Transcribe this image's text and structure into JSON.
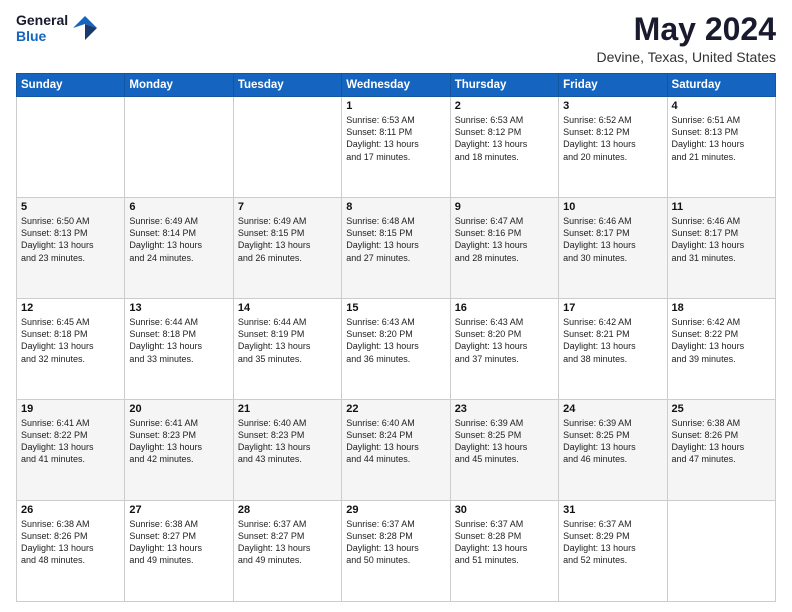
{
  "header": {
    "logo_line1": "General",
    "logo_line2": "Blue",
    "title": "May 2024",
    "subtitle": "Devine, Texas, United States"
  },
  "weekdays": [
    "Sunday",
    "Monday",
    "Tuesday",
    "Wednesday",
    "Thursday",
    "Friday",
    "Saturday"
  ],
  "weeks": [
    [
      {
        "day": "",
        "info": ""
      },
      {
        "day": "",
        "info": ""
      },
      {
        "day": "",
        "info": ""
      },
      {
        "day": "1",
        "info": "Sunrise: 6:53 AM\nSunset: 8:11 PM\nDaylight: 13 hours\nand 17 minutes."
      },
      {
        "day": "2",
        "info": "Sunrise: 6:53 AM\nSunset: 8:12 PM\nDaylight: 13 hours\nand 18 minutes."
      },
      {
        "day": "3",
        "info": "Sunrise: 6:52 AM\nSunset: 8:12 PM\nDaylight: 13 hours\nand 20 minutes."
      },
      {
        "day": "4",
        "info": "Sunrise: 6:51 AM\nSunset: 8:13 PM\nDaylight: 13 hours\nand 21 minutes."
      }
    ],
    [
      {
        "day": "5",
        "info": "Sunrise: 6:50 AM\nSunset: 8:13 PM\nDaylight: 13 hours\nand 23 minutes."
      },
      {
        "day": "6",
        "info": "Sunrise: 6:49 AM\nSunset: 8:14 PM\nDaylight: 13 hours\nand 24 minutes."
      },
      {
        "day": "7",
        "info": "Sunrise: 6:49 AM\nSunset: 8:15 PM\nDaylight: 13 hours\nand 26 minutes."
      },
      {
        "day": "8",
        "info": "Sunrise: 6:48 AM\nSunset: 8:15 PM\nDaylight: 13 hours\nand 27 minutes."
      },
      {
        "day": "9",
        "info": "Sunrise: 6:47 AM\nSunset: 8:16 PM\nDaylight: 13 hours\nand 28 minutes."
      },
      {
        "day": "10",
        "info": "Sunrise: 6:46 AM\nSunset: 8:17 PM\nDaylight: 13 hours\nand 30 minutes."
      },
      {
        "day": "11",
        "info": "Sunrise: 6:46 AM\nSunset: 8:17 PM\nDaylight: 13 hours\nand 31 minutes."
      }
    ],
    [
      {
        "day": "12",
        "info": "Sunrise: 6:45 AM\nSunset: 8:18 PM\nDaylight: 13 hours\nand 32 minutes."
      },
      {
        "day": "13",
        "info": "Sunrise: 6:44 AM\nSunset: 8:18 PM\nDaylight: 13 hours\nand 33 minutes."
      },
      {
        "day": "14",
        "info": "Sunrise: 6:44 AM\nSunset: 8:19 PM\nDaylight: 13 hours\nand 35 minutes."
      },
      {
        "day": "15",
        "info": "Sunrise: 6:43 AM\nSunset: 8:20 PM\nDaylight: 13 hours\nand 36 minutes."
      },
      {
        "day": "16",
        "info": "Sunrise: 6:43 AM\nSunset: 8:20 PM\nDaylight: 13 hours\nand 37 minutes."
      },
      {
        "day": "17",
        "info": "Sunrise: 6:42 AM\nSunset: 8:21 PM\nDaylight: 13 hours\nand 38 minutes."
      },
      {
        "day": "18",
        "info": "Sunrise: 6:42 AM\nSunset: 8:22 PM\nDaylight: 13 hours\nand 39 minutes."
      }
    ],
    [
      {
        "day": "19",
        "info": "Sunrise: 6:41 AM\nSunset: 8:22 PM\nDaylight: 13 hours\nand 41 minutes."
      },
      {
        "day": "20",
        "info": "Sunrise: 6:41 AM\nSunset: 8:23 PM\nDaylight: 13 hours\nand 42 minutes."
      },
      {
        "day": "21",
        "info": "Sunrise: 6:40 AM\nSunset: 8:23 PM\nDaylight: 13 hours\nand 43 minutes."
      },
      {
        "day": "22",
        "info": "Sunrise: 6:40 AM\nSunset: 8:24 PM\nDaylight: 13 hours\nand 44 minutes."
      },
      {
        "day": "23",
        "info": "Sunrise: 6:39 AM\nSunset: 8:25 PM\nDaylight: 13 hours\nand 45 minutes."
      },
      {
        "day": "24",
        "info": "Sunrise: 6:39 AM\nSunset: 8:25 PM\nDaylight: 13 hours\nand 46 minutes."
      },
      {
        "day": "25",
        "info": "Sunrise: 6:38 AM\nSunset: 8:26 PM\nDaylight: 13 hours\nand 47 minutes."
      }
    ],
    [
      {
        "day": "26",
        "info": "Sunrise: 6:38 AM\nSunset: 8:26 PM\nDaylight: 13 hours\nand 48 minutes."
      },
      {
        "day": "27",
        "info": "Sunrise: 6:38 AM\nSunset: 8:27 PM\nDaylight: 13 hours\nand 49 minutes."
      },
      {
        "day": "28",
        "info": "Sunrise: 6:37 AM\nSunset: 8:27 PM\nDaylight: 13 hours\nand 49 minutes."
      },
      {
        "day": "29",
        "info": "Sunrise: 6:37 AM\nSunset: 8:28 PM\nDaylight: 13 hours\nand 50 minutes."
      },
      {
        "day": "30",
        "info": "Sunrise: 6:37 AM\nSunset: 8:28 PM\nDaylight: 13 hours\nand 51 minutes."
      },
      {
        "day": "31",
        "info": "Sunrise: 6:37 AM\nSunset: 8:29 PM\nDaylight: 13 hours\nand 52 minutes."
      },
      {
        "day": "",
        "info": ""
      }
    ]
  ]
}
